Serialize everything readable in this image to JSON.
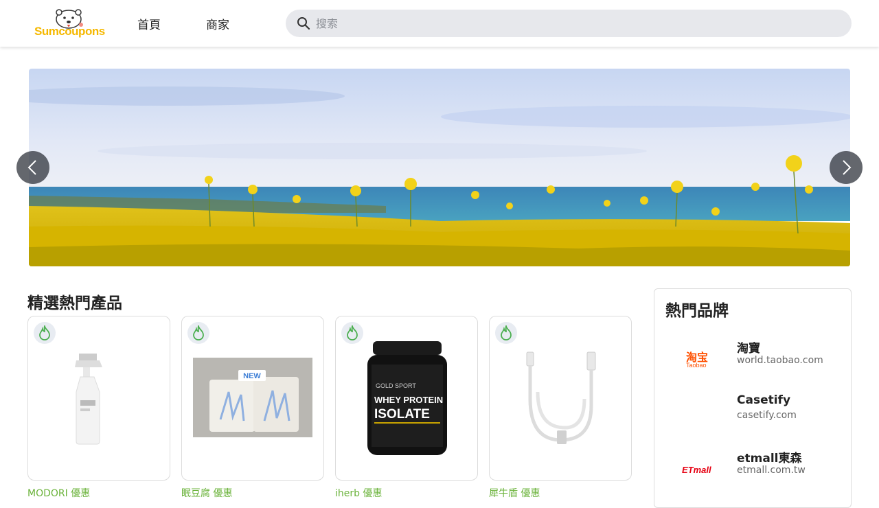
{
  "header": {
    "logo_text": "Sumcoupons",
    "nav": [
      "首頁",
      "商家"
    ],
    "search_placeholder": "搜索"
  },
  "featured": {
    "title": "精選熱門產品",
    "products": [
      {
        "label": "MODORI 優惠",
        "image": "spray-bottle"
      },
      {
        "label": "眠豆腐 優惠",
        "image": "pillow-new"
      },
      {
        "label": "iherb 優惠",
        "image": "whey-protein-isolate"
      },
      {
        "label": "犀牛盾 優惠",
        "image": "usb-cable"
      }
    ],
    "product_image_text": {
      "new_tag": "NEW",
      "whey_brand": "GOLD SPORT",
      "whey_line1": "WHEY PROTEIN",
      "whey_line2": "ISOLATE"
    }
  },
  "brands": {
    "title": "熱門品牌",
    "items": [
      {
        "name": "淘寶",
        "url": "world.taobao.com",
        "logo_text": "淘宝",
        "logo_sub": "Taobao"
      },
      {
        "name": "Casetify",
        "url": "casetify.com",
        "logo_text": "",
        "logo_sub": ""
      },
      {
        "name": "etmall東森",
        "url": "etmall.com.tw",
        "logo_text": "ETmall",
        "logo_sub": ""
      }
    ]
  },
  "colors": {
    "accent_green": "#6bb33b",
    "logo_yellow": "#f5b800",
    "taobao_orange": "#ff5000",
    "etmall_red": "#e60012"
  }
}
